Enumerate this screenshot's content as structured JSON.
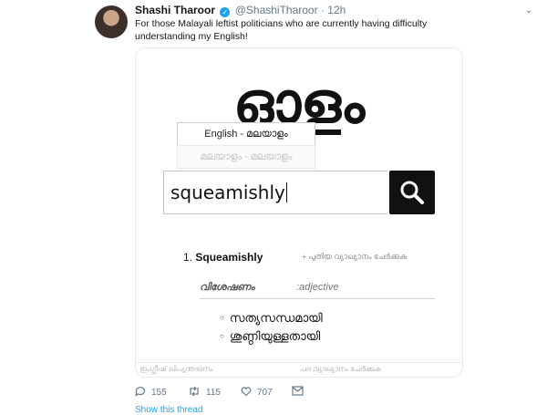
{
  "tweet": {
    "author": "Shashi Tharoor",
    "handle": "@ShashiTharoor",
    "separator": "·",
    "time": "12h",
    "text": "For those Malayali leftist politicians who are currently having difficulty understanding my English!",
    "more_icon": "chevron-down-icon",
    "verified_icon": "verified-check-icon"
  },
  "card": {
    "logo": "ഓളം",
    "lang_options": [
      "English - മലയാളം",
      "മലയാളം - മലയാളം"
    ],
    "search": {
      "value": "squeamishly",
      "button_icon": "search-icon"
    },
    "entry": {
      "number": "1.",
      "word": "Squeamishly",
      "add_meaning": "+ പുതിയ വ്യാഖ്യാനം ചേർക്കുക"
    },
    "pos": {
      "malayalam": "വിശേഷണം",
      "english": ":adjective"
    },
    "meanings": [
      "സത്യസന്ധമായി",
      "ശുണ്ഠിയുള്ളതായി"
    ],
    "footer": {
      "left": "ഇംഗ്ലീഷ് ലിപ്യന്തരണം",
      "right": "പദ വ്യാഖ്യാനം ചേർക്കുക"
    }
  },
  "actions": {
    "reply": {
      "icon": "reply-icon",
      "count": "155"
    },
    "retweet": {
      "icon": "retweet-icon",
      "count": "115"
    },
    "like": {
      "icon": "heart-icon",
      "count": "707"
    },
    "dm": {
      "icon": "envelope-icon"
    }
  },
  "thread_link": "Show this thread",
  "colors": {
    "link": "#1da1f2",
    "muted": "#657786",
    "search_button": "#111111"
  }
}
